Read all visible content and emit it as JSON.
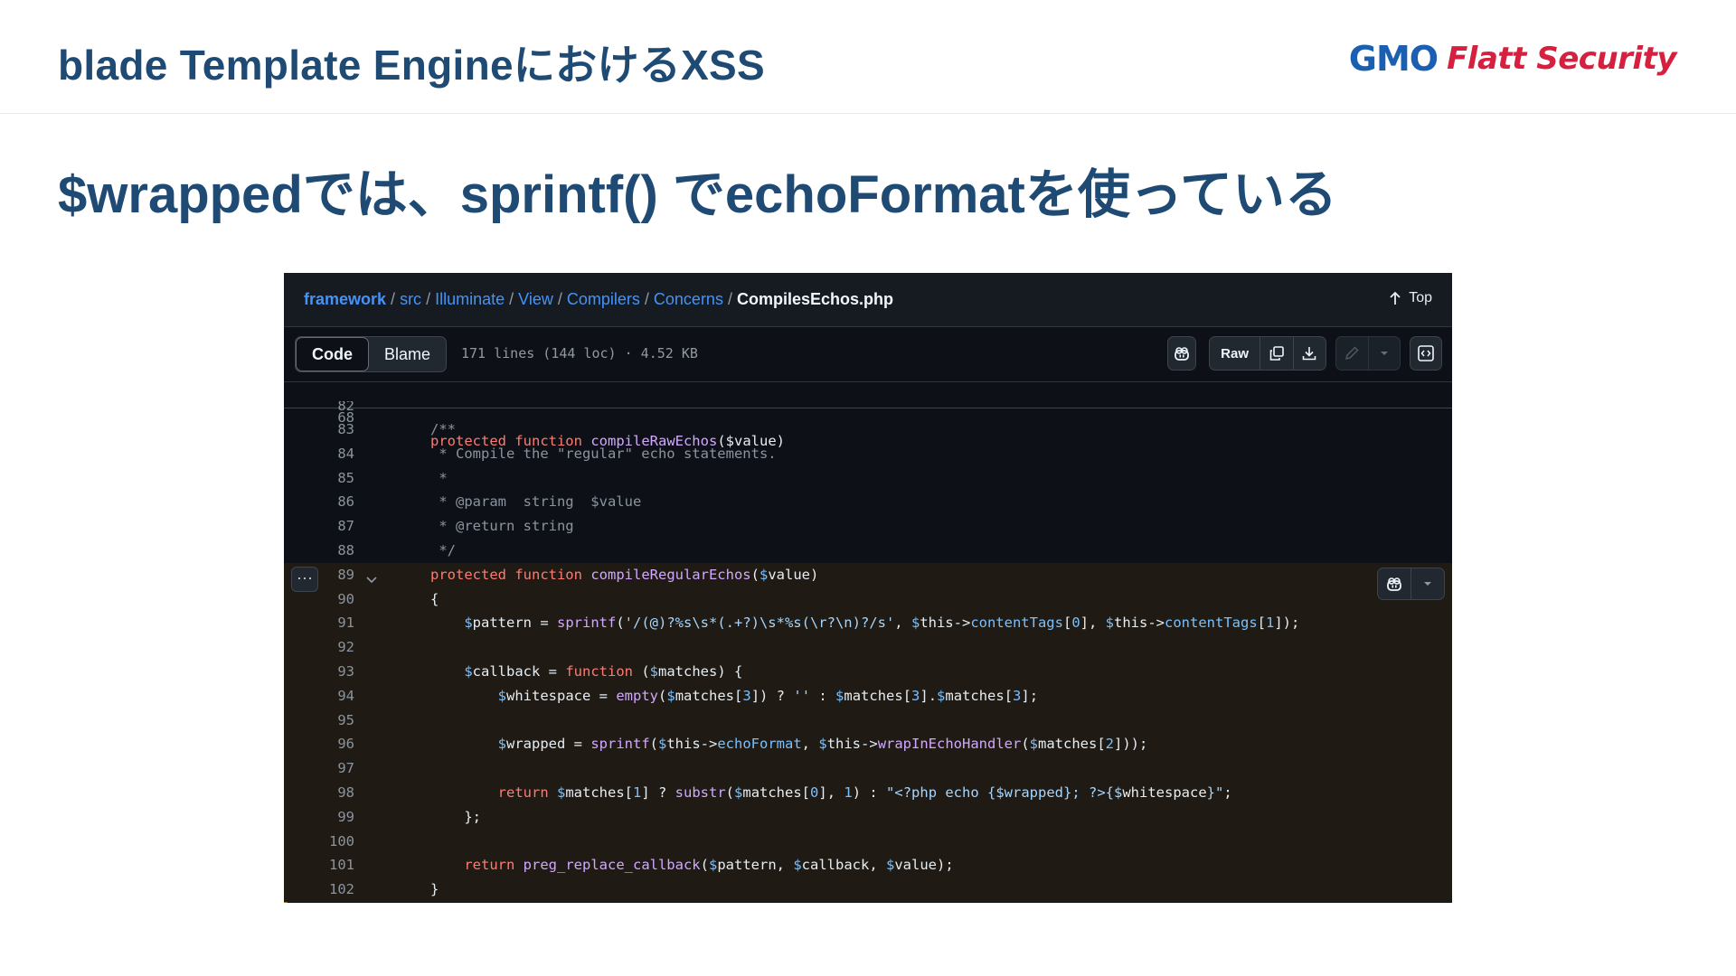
{
  "slide": {
    "title": "blade Template EngineにおけるXSS",
    "subtitle": "$wrappedでは、sprintf() でechoFormatを使っている",
    "logo": {
      "gmo": "GMO",
      "flatt": "Flatt Security"
    }
  },
  "viewer": {
    "breadcrumb": [
      "framework",
      "src",
      "Illuminate",
      "View",
      "Compilers",
      "Concerns"
    ],
    "file_name": "CompilesEchos.php",
    "top_label": "Top",
    "tabs": {
      "code": "Code",
      "blame": "Blame"
    },
    "file_info": "171 lines (144 loc) · 4.52 KB",
    "raw_label": "Raw",
    "sticky": {
      "number": "68",
      "keyword": "protected function",
      "fn": "compileRawEchos",
      "arg": "$value"
    }
  },
  "code_lines": [
    {
      "n": "82",
      "html": ""
    },
    {
      "n": "83",
      "html": "<span class=\"tk-cm\">/**</span>"
    },
    {
      "n": "84",
      "html": "<span class=\"tk-cm\"> * Compile the \"regular\" echo statements.</span>"
    },
    {
      "n": "85",
      "html": "<span class=\"tk-cm\"> *</span>"
    },
    {
      "n": "86",
      "html": "<span class=\"tk-cm\"> * @param  string  $value</span>"
    },
    {
      "n": "87",
      "html": "<span class=\"tk-cm\"> * @return string</span>"
    },
    {
      "n": "88",
      "html": "<span class=\"tk-cm\"> */</span>"
    },
    {
      "n": "89",
      "hl": true,
      "html": "<span class=\"tk-kw\">protected function</span> <span class=\"tk-fn\">compileRegularEchos</span>(<span class=\"tk-var\">$</span>value)"
    },
    {
      "n": "90",
      "hl": true,
      "html": "{"
    },
    {
      "n": "91",
      "hl": true,
      "html": "    <span class=\"tk-var\">$</span>pattern = <span class=\"tk-fn\">sprintf</span>(<span class=\"tk-str\">'/(@)?%s\\s*(.+?)\\s*%s(\\r?\\n)?/s'</span>, <span class=\"tk-var\">$</span>this-><span class=\"tk-prop\">contentTags</span>[<span class=\"tk-num\">0</span>], <span class=\"tk-var\">$</span>this-><span class=\"tk-prop\">contentTags</span>[<span class=\"tk-num\">1</span>]);"
    },
    {
      "n": "92",
      "hl": true,
      "html": ""
    },
    {
      "n": "93",
      "hl": true,
      "html": "    <span class=\"tk-var\">$</span>callback = <span class=\"tk-kw\">function</span> (<span class=\"tk-var\">$</span>matches) {"
    },
    {
      "n": "94",
      "hl": true,
      "html": "        <span class=\"tk-var\">$</span>whitespace = <span class=\"tk-fn\">empty</span>(<span class=\"tk-var\">$</span>matches[<span class=\"tk-num\">3</span>]) ? <span class=\"tk-str\">''</span> : <span class=\"tk-var\">$</span>matches[<span class=\"tk-num\">3</span>].<span class=\"tk-var\">$</span>matches[<span class=\"tk-num\">3</span>];"
    },
    {
      "n": "95",
      "hl": true,
      "html": ""
    },
    {
      "n": "96",
      "hl": true,
      "html": "        <span class=\"tk-var\">$</span>wrapped = <span class=\"tk-fn\">sprintf</span>(<span class=\"tk-var\">$</span>this-><span class=\"tk-prop\">echoFormat</span>, <span class=\"tk-var\">$</span>this-><span class=\"tk-fn\">wrapInEchoHandler</span>(<span class=\"tk-var\">$</span>matches[<span class=\"tk-num\">2</span>]));"
    },
    {
      "n": "97",
      "hl": true,
      "html": ""
    },
    {
      "n": "98",
      "hl": true,
      "html": "        <span class=\"tk-kw\">return</span> <span class=\"tk-var\">$</span>matches[<span class=\"tk-num\">1</span>] ? <span class=\"tk-fn\">substr</span>(<span class=\"tk-var\">$</span>matches[<span class=\"tk-num\">0</span>], <span class=\"tk-num\">1</span>) : <span class=\"tk-str\">\"&lt;?php echo {$wrapped}; ?&gt;{$</span>whitespace<span class=\"tk-str\">}\"</span>;"
    },
    {
      "n": "99",
      "hl": true,
      "html": "    };"
    },
    {
      "n": "100",
      "hl": true,
      "html": ""
    },
    {
      "n": "101",
      "hl": true,
      "html": "    <span class=\"tk-kw\">return</span> <span class=\"tk-fn\">preg_replace_callback</span>(<span class=\"tk-var\">$</span>pattern, <span class=\"tk-var\">$</span>callback, <span class=\"tk-var\">$</span>value);"
    },
    {
      "n": "102",
      "hl": true,
      "html": "}"
    }
  ]
}
